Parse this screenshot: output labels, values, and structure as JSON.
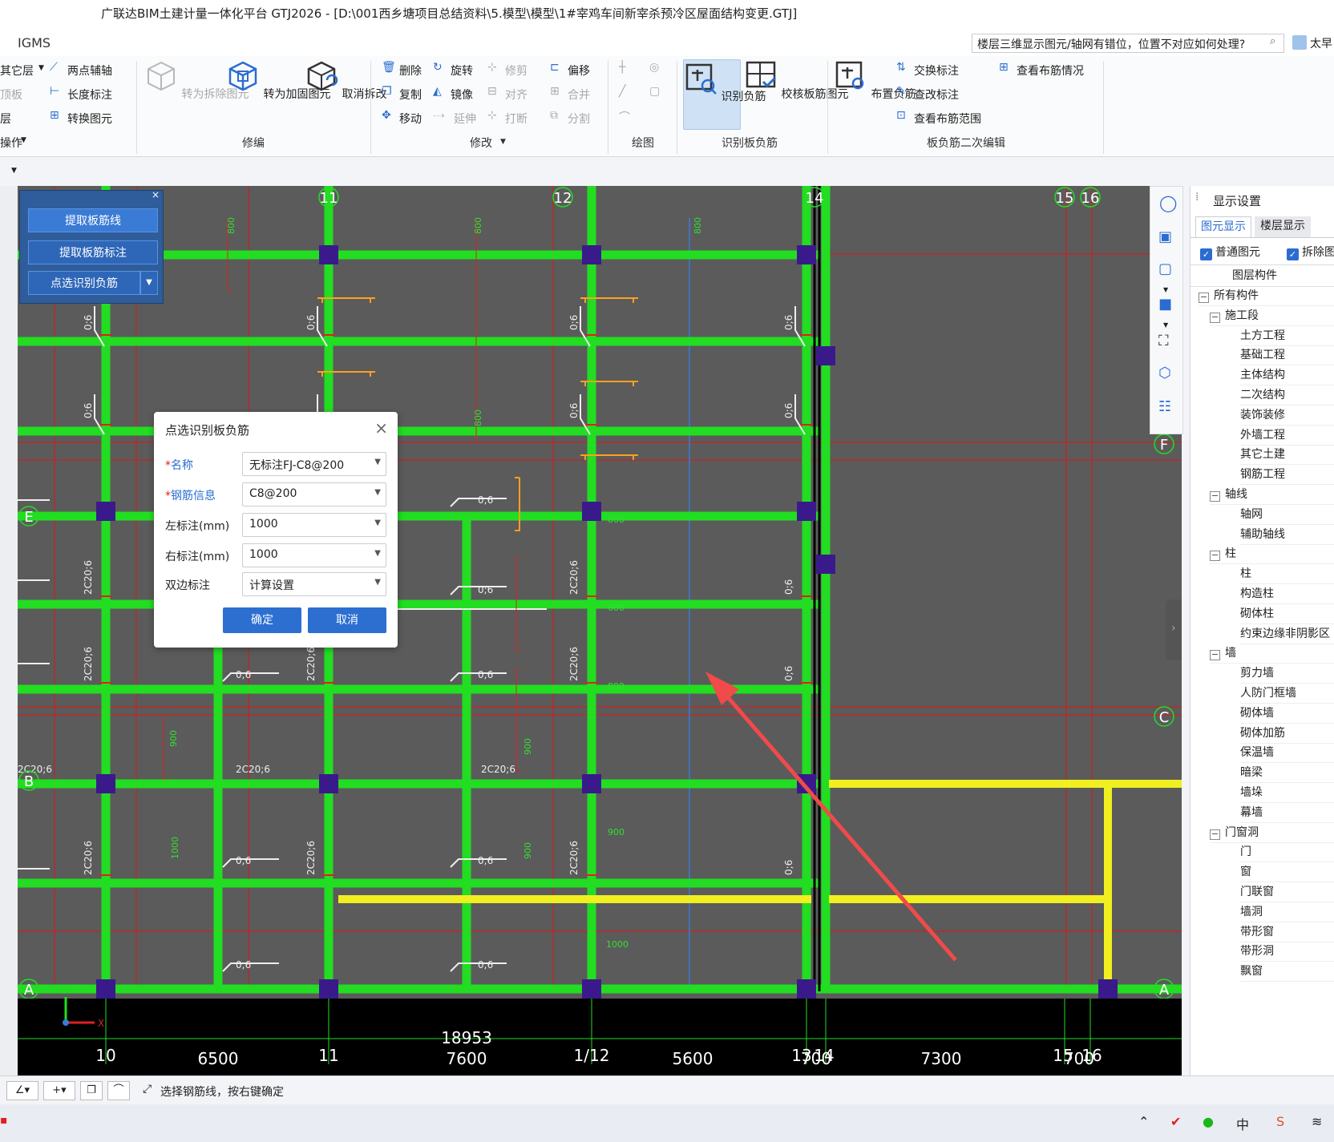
{
  "window": {
    "title": "广联达BIM土建计量一体化平台 GTJ2026 - [D:\\001西乡塘项目总结资料\\5.模型\\模型\\1#宰鸡车间新宰杀预冷区屋面结构变更.GTJ]"
  },
  "menubar": {
    "brand": "IGMS",
    "help_text": "楼层三维显示图元/轴网有错位，位置不对应如何处理?",
    "user": "太早"
  },
  "ribbon": {
    "left_items": [
      "其它层",
      "顶板",
      "层",
      "操作"
    ],
    "axis_items": [
      "两点辅轴",
      "长度标注",
      "转换图元"
    ],
    "repair_buttons": [
      "转为拆除图元",
      "转为加固图元",
      "取消拆改"
    ],
    "repair_group": "修编",
    "modify_items": [
      [
        "删除",
        "旋转",
        "修剪",
        "偏移"
      ],
      [
        "复制",
        "镜像",
        "对齐",
        "合并"
      ],
      [
        "移动",
        "延伸",
        "打断",
        "分割"
      ]
    ],
    "modify_group": "修改",
    "draw_group": "绘图",
    "identify_buttons": [
      "识别负筋",
      "校核板筋图元"
    ],
    "identify_group": "识别板负筋",
    "layout_button": "布置负筋",
    "edit_items": [
      "交换标注",
      "查改标注",
      "查看布筋范围",
      "查看布筋情况"
    ],
    "edit_group": "板负筋二次编辑"
  },
  "left_panel": {
    "buttons": [
      "提取板筋线",
      "提取板筋标注",
      "点选识别负筋"
    ]
  },
  "dialog": {
    "title": "点选识别板负筋",
    "fields": [
      {
        "label": "名称",
        "required": true,
        "value": "无标注FJ-C8@200"
      },
      {
        "label": "钢筋信息",
        "required": true,
        "value": "C8@200"
      },
      {
        "label": "左标注(mm)",
        "required": false,
        "value": "1000"
      },
      {
        "label": "右标注(mm)",
        "required": false,
        "value": "1000"
      },
      {
        "label": "双边标注",
        "required": false,
        "value": "计算设置"
      }
    ],
    "ok": "确定",
    "cancel": "取消"
  },
  "canvas": {
    "axis_top": [
      "11",
      "12",
      "14",
      "15",
      "16"
    ],
    "axis_right": [
      "F",
      "C",
      "A"
    ],
    "axis_left": [
      "E",
      "B",
      "A"
    ],
    "bottom_numbers": [
      "10",
      "11",
      "1/12",
      "13",
      "14",
      "15",
      "16"
    ],
    "dimensions": [
      "6500",
      "18953",
      "7600",
      "5600",
      "700",
      "7300",
      "700"
    ],
    "labels": {
      "rebar_a": "0;6",
      "rebar_b": "2C20;6",
      "dim_800": "800",
      "dim_900": "900",
      "dim_1000": "1000",
      "dim_600": "600"
    }
  },
  "right_panel": {
    "title": "显示设置",
    "tabs": [
      "图元显示",
      "楼层显示"
    ],
    "checks": [
      "普通图元",
      "拆除图元"
    ],
    "header": "图层构件",
    "tree": [
      {
        "label": "所有构件",
        "level": 0,
        "group": true
      },
      {
        "label": "施工段",
        "level": 1,
        "group": true
      },
      {
        "label": "土方工程",
        "level": 2
      },
      {
        "label": "基础工程",
        "level": 2
      },
      {
        "label": "主体结构",
        "level": 2
      },
      {
        "label": "二次结构",
        "level": 2
      },
      {
        "label": "装饰装修",
        "level": 2
      },
      {
        "label": "外墙工程",
        "level": 2
      },
      {
        "label": "其它土建",
        "level": 2
      },
      {
        "label": "钢筋工程",
        "level": 2
      },
      {
        "label": "轴线",
        "level": 1,
        "group": true
      },
      {
        "label": "轴网",
        "level": 2
      },
      {
        "label": "辅助轴线",
        "level": 2
      },
      {
        "label": "柱",
        "level": 1,
        "group": true
      },
      {
        "label": "柱",
        "level": 2
      },
      {
        "label": "构造柱",
        "level": 2
      },
      {
        "label": "砌体柱",
        "level": 2
      },
      {
        "label": "约束边缘非阴影区",
        "level": 2
      },
      {
        "label": "墙",
        "level": 1,
        "group": true
      },
      {
        "label": "剪力墙",
        "level": 2
      },
      {
        "label": "人防门框墙",
        "level": 2
      },
      {
        "label": "砌体墙",
        "level": 2
      },
      {
        "label": "砌体加筋",
        "level": 2
      },
      {
        "label": "保温墙",
        "level": 2
      },
      {
        "label": "暗梁",
        "level": 2
      },
      {
        "label": "墙垛",
        "level": 2
      },
      {
        "label": "幕墙",
        "level": 2
      },
      {
        "label": "门窗洞",
        "level": 1,
        "group": true
      },
      {
        "label": "门",
        "level": 2
      },
      {
        "label": "窗",
        "level": 2
      },
      {
        "label": "门联窗",
        "level": 2
      },
      {
        "label": "墙洞",
        "level": 2
      },
      {
        "label": "带形窗",
        "level": 2
      },
      {
        "label": "带形洞",
        "level": 2
      },
      {
        "label": "飘窗",
        "level": 2
      }
    ]
  },
  "statusbar": {
    "hint": "选择钢筋线，按右键确定"
  },
  "taskbar": {
    "ime": "中"
  },
  "colors": {
    "canvas_bg": "#5b5b5b",
    "beam_green": "#22dd22",
    "beam_yellow": "#f0f020",
    "axis_red": "#cc2020",
    "accent_blue": "#2c6fd1"
  }
}
